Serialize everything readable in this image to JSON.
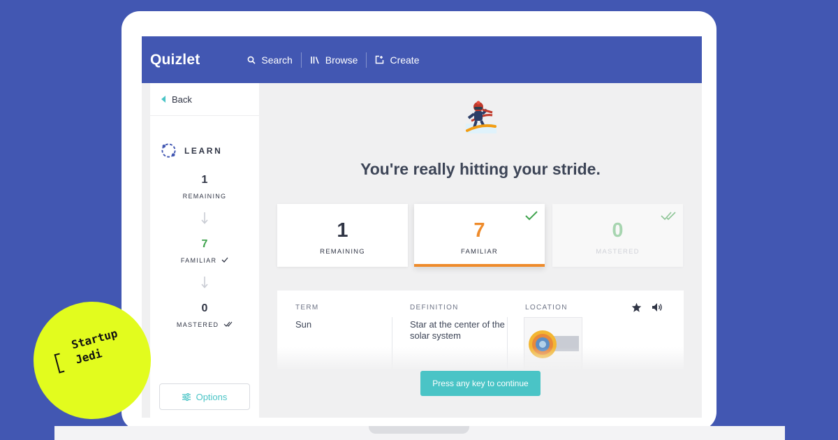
{
  "app": {
    "brand": "Quizlet",
    "colors": {
      "brand": "#4257b2",
      "accent": "#4ac4c6",
      "familiar": "#ee8b2b",
      "mastered": "#3fa34d"
    }
  },
  "nav": {
    "items": [
      {
        "label": "Search",
        "icon": "search-icon"
      },
      {
        "label": "Browse",
        "icon": "library-icon"
      },
      {
        "label": "Create",
        "icon": "create-icon"
      }
    ]
  },
  "sidebar": {
    "back_label": "Back",
    "mode_label": "LEARN",
    "remaining": {
      "value": "1",
      "label": "REMAINING"
    },
    "familiar": {
      "value": "7",
      "label": "FAMILIAR"
    },
    "mastered": {
      "value": "0",
      "label": "MASTERED"
    },
    "options_label": "Options"
  },
  "main": {
    "headline": "You're really hitting your stride.",
    "cards": [
      {
        "value": "1",
        "label": "REMAINING"
      },
      {
        "value": "7",
        "label": "FAMILIAR"
      },
      {
        "value": "0",
        "label": "MASTERED"
      }
    ],
    "term_panel": {
      "term_header": "TERM",
      "term": "Sun",
      "definition_header": "DEFINITION",
      "definition": "Star at the center of the solar system",
      "location_header": "LOCATION"
    },
    "continue_label": "Press any key to continue"
  },
  "badge": {
    "line1": "Startup",
    "line2": "Jedi"
  }
}
